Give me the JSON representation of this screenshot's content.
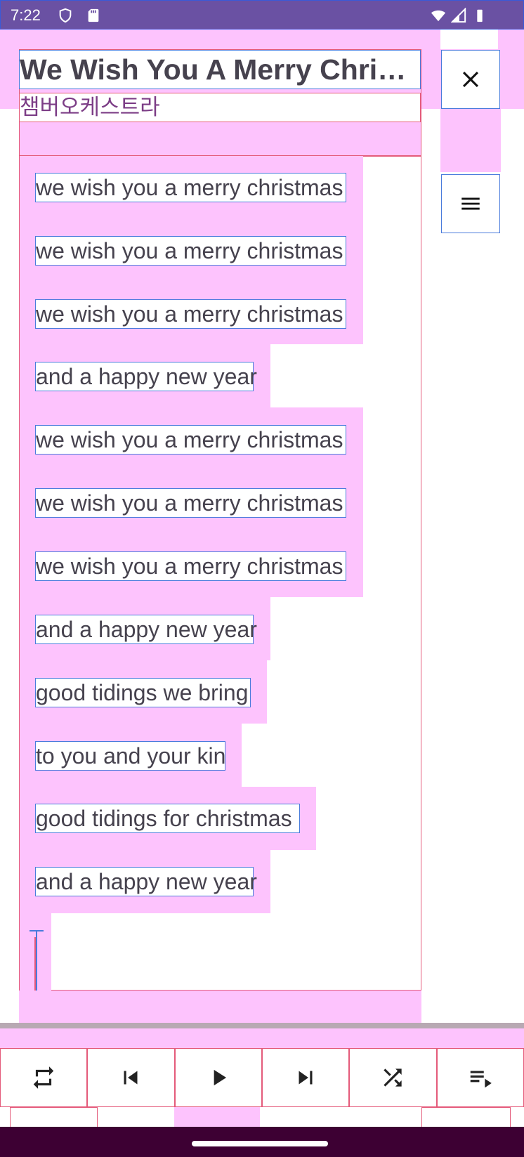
{
  "status_bar": {
    "time": "7:22",
    "icons": [
      "shield-icon",
      "sd-card-icon",
      "wifi-icon",
      "signal-icon",
      "battery-icon"
    ]
  },
  "header": {
    "title": "We Wish You A Merry Christmas",
    "artist": "챔버오케스트라",
    "close_icon": "close-icon",
    "menu_icon": "hamburger-menu-icon"
  },
  "lyrics": [
    "we wish you a merry christmas",
    "we wish you a merry christmas",
    "we wish you a merry christmas",
    "and a happy new year",
    "we wish you a merry christmas",
    "we wish you a merry christmas",
    "we wish you a merry christmas",
    "and a happy new year",
    "good tidings we bring",
    "to you and your kin",
    "good tidings for christmas",
    "and a happy new year"
  ],
  "playback": {
    "progress_fraction": 0.0,
    "controls": [
      "repeat-icon",
      "previous-icon",
      "play-icon",
      "next-icon",
      "shuffle-icon",
      "playlist-icon"
    ]
  },
  "colors": {
    "status_bar": "#6a51a3",
    "overlay_pink": "#fdc3fd",
    "nav_bar": "#3d0033",
    "text": "#46424e",
    "artist_text": "#7c3d86"
  }
}
